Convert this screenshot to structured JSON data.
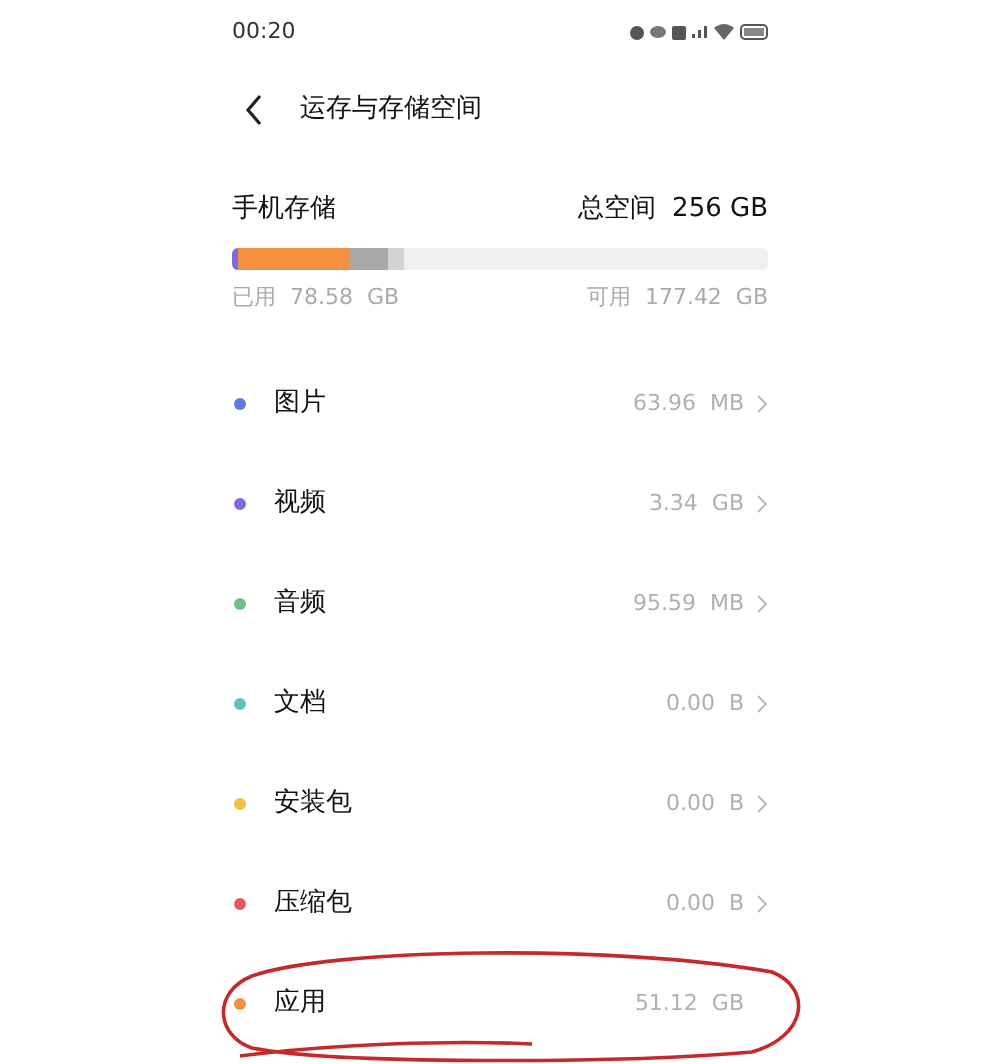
{
  "status_bar": {
    "time": "00:20"
  },
  "header": {
    "title": "运存与存储空间"
  },
  "storage": {
    "title": "手机存储",
    "total": "总空间  256 GB",
    "used": "已用  78.58  GB",
    "free": "可用  177.42  GB",
    "segments": [
      {
        "color": "#7a6be0",
        "level": 0.012
      },
      {
        "color": "#f5913e",
        "level": 0.21
      },
      {
        "color": "#a9a9a9"
      },
      {
        "color": "#d3d3d3"
      }
    ]
  },
  "categories": [
    {
      "name": "图片",
      "size": "63.96  MB",
      "color": "#5b7be6",
      "chevron": true
    },
    {
      "name": "视频",
      "size": "3.34  GB",
      "color": "#7a6be0",
      "chevron": true
    },
    {
      "name": "音频",
      "size": "95.59  MB",
      "color": "#6cc283",
      "chevron": true
    },
    {
      "name": "文档",
      "size": "0.00  B",
      "color": "#5bbfc4",
      "chevron": true
    },
    {
      "name": "安装包",
      "size": "0.00  B",
      "color": "#f0c040",
      "chevron": true
    },
    {
      "name": "压缩包",
      "size": "0.00  B",
      "color": "#e35a5a",
      "chevron": true
    },
    {
      "name": "应用",
      "size": "51.12  GB",
      "color": "#f0913e",
      "chevron": false
    }
  ]
}
